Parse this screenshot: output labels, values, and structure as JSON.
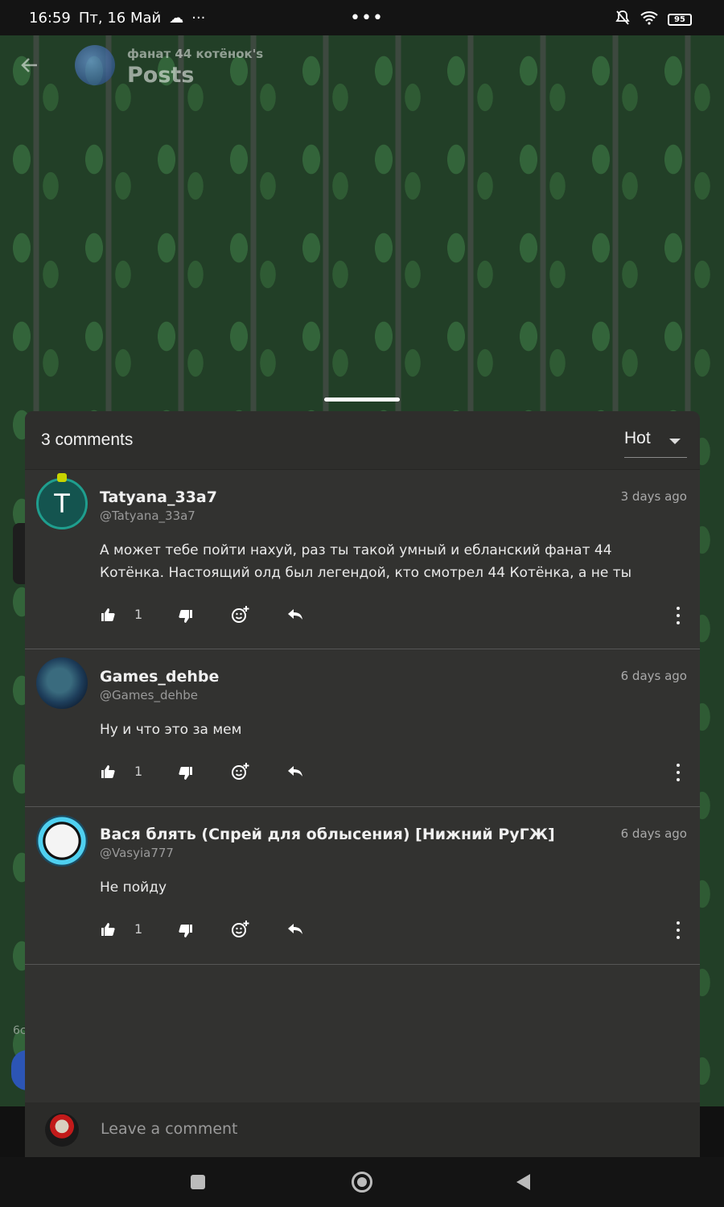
{
  "status_bar": {
    "time": "16:59",
    "date": "Пт, 16 Май",
    "dots": "•••",
    "battery": "95"
  },
  "header": {
    "subtitle": "фанат 44 котёнок's",
    "title": "Posts",
    "back_icon": "arrow-left-icon"
  },
  "comments_panel": {
    "count_label": "3 comments",
    "sort_label": "Hot"
  },
  "comments": [
    {
      "author": "Tatyana_33a7",
      "handle": "@Tatyana_33a7",
      "time": "3 days ago",
      "avatar_letter": "T",
      "text": "А может тебе пойти нахуй, раз ты такой умный и ебланский фанат 44 Котёнка. Настоящий олд был легендой, кто смотрел 44 Котёнка, а не ты",
      "likes": "1"
    },
    {
      "author": "Games_dehbe",
      "handle": "@Games_dehbe",
      "time": "6 days ago",
      "text": "Ну и что это за мем",
      "likes": "1"
    },
    {
      "author": "Вася блять (Спрей для облысения) [Нижний РуГЖ]",
      "handle": "@Vasyia777",
      "time": "6 days ago",
      "text": "Не пойду",
      "likes": "1"
    }
  ],
  "composer": {
    "placeholder": "Leave a comment"
  },
  "edge": {
    "peek_text": "6с"
  },
  "colors": {
    "sheet_bg": "#323230",
    "accent_teal": "#1f9e8e",
    "nav_bg": "#141414"
  }
}
